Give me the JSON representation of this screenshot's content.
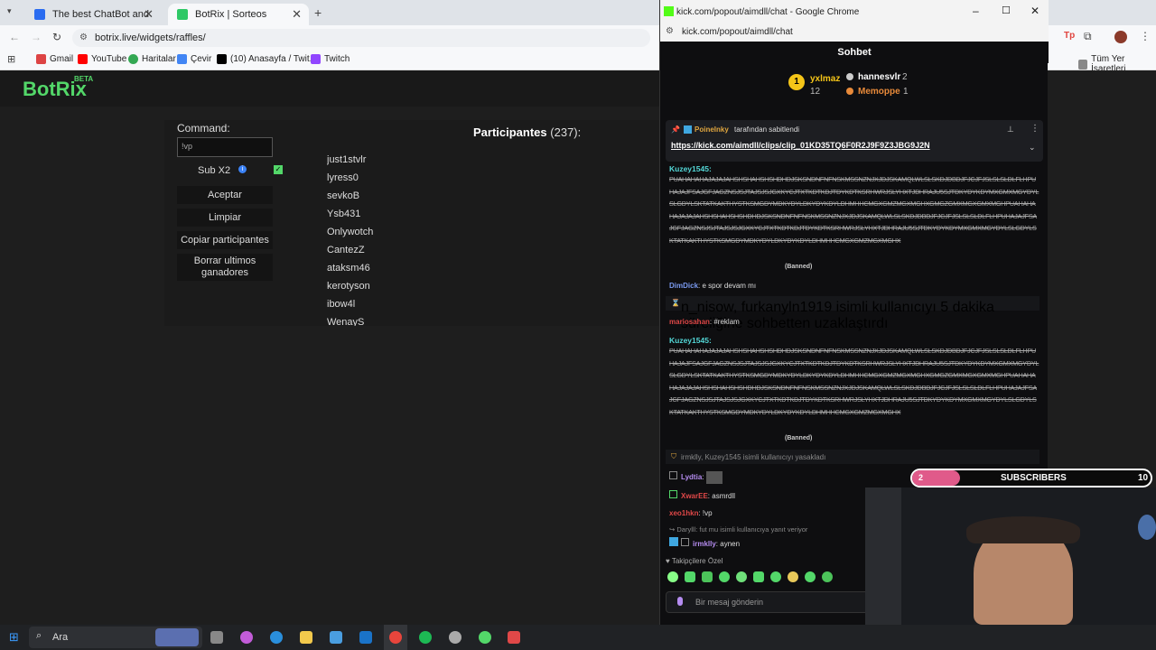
{
  "browser": {
    "tabs": [
      {
        "title": "The best ChatBot and Widgets",
        "active": false
      },
      {
        "title": "BotRix | Sorteos",
        "active": true
      }
    ],
    "url": "botrix.live/widgets/raffles/",
    "bookmarks": [
      "Gmail",
      "YouTube",
      "Haritalar",
      "Çevir",
      "(10) Anasayfa / Twit...",
      "Twitch"
    ],
    "bookmarks_right": "Tüm Yer İşaretleri"
  },
  "site": {
    "logo": "BotRix",
    "logo_badge": "BETA"
  },
  "raffle": {
    "command_label": "Command:",
    "command_value": "!vp",
    "sub_label": "Sub X2",
    "buttons": [
      "Aceptar",
      "Limpiar",
      "Copiar participantes",
      "Borrar ultimos ganadores"
    ],
    "participants_title": "Participantes",
    "participants_count": "(237):",
    "participants": [
      "just1stvlr",
      "lyress0",
      "sevkoB",
      "Ysb431",
      "Onlywotch",
      "CantezZ",
      "ataksm46",
      "kerotyson",
      "ibow4l",
      "WenayS"
    ]
  },
  "chat": {
    "window_title": "kick.com/popout/aimdll/chat - Google Chrome",
    "url": "kick.com/popout/aimdll/chat",
    "header": "Sohbet",
    "top_supporters": [
      {
        "name": "yxlmaz",
        "count": "12"
      },
      {
        "name": "hannesvlr",
        "count": "2"
      },
      {
        "name": "Memoppe",
        "count": "1"
      }
    ],
    "pinned_by": "Poinelnky",
    "pinned_suffix": "tarafından sabitlendi",
    "pinned_link": "https://kick.com/aimdll/clips/clip_01KD35TQ6F0R2J9F9Z3JBG9J2N",
    "spam_user": "Kuzey1545:",
    "spam_text": "PUAHAHAHAJAJAJAHSHSHAHSHSHDHDJSKSNDNFNFNSKMSSNZNJXJDJSKAMQLWLSLSKDJDBDJFJCJFJSLSLSLDLFLHPUHAJAJFSAJGFJAGZNSJSJTAJSJSJGXKYCJTXTKDTKDJTDYKDTKSRHWRJSLYHXTJDHRAJU5SJTDKYDYKDYMXGMXMGYDYLSLGDYLSKTATKAKTHYSTKSMGDYMDKYDYLDKYDYKDYLDHMHHCMGXGMZMGXMGHXGMGZGMXMGXGMXMGHPUAHAHAHAJAJAJAHSHSHAHSHSHDHDJSKSNDNFNFNSKMSSNZNJXJDJSKAMQLWLSLSKDJDBDJFJCJFJSLSLSLDLFLHPUHAJAJFSAJGFJAGZNSJSJTAJSJSJGXKYCJTXTKDTKDJTDYKDTKSRHWRJSLYHXTJDHRAJU5SJTDKYDYKDYMXGMXMGYDYLSLGDYLSKTATKAKTHYSTKSMGDYMDKYDYLDKYDYKDYLDHMHHCMGXGMZMGXMGHX",
    "banned_tag": "(Banned)",
    "msg_dim_user": "DimDick",
    "msg_dim_text": ": e spor devam mı",
    "timeout_notice": "n_nisow, furkanyln1919 isimli kullanıcıyı 5 dakika süreliğine sohbetten uzaklaştırdı",
    "msg_mario_user": "mariosahan",
    "msg_mario_text": ": #reklam",
    "ban_notice": "irmklly, Kuzey1545 isimli kullanıcıyı yasakladı",
    "msg_lydia_user": "Lydtia",
    "msg_xware_user": "XwarEE",
    "msg_xware_text": ": asmrdll",
    "msg_xeo_user": "xeo1hkn",
    "msg_xeo_text": ": !vp",
    "reply_notice": "Darylll: fut mu isimli kullanıcıya yanıt veriyor",
    "msg_irm_user": "irmklly",
    "msg_irm_text": ": aynen",
    "followers_only": "Takipçilere Özel",
    "input_placeholder": "Bir mesaj gönderin"
  },
  "overlay": {
    "sub_label": "SUBSCRIBERS",
    "sub_current": "2",
    "sub_goal": "10",
    "sub_progress": 0.2
  },
  "taskbar": {
    "search_placeholder": "Ara"
  }
}
